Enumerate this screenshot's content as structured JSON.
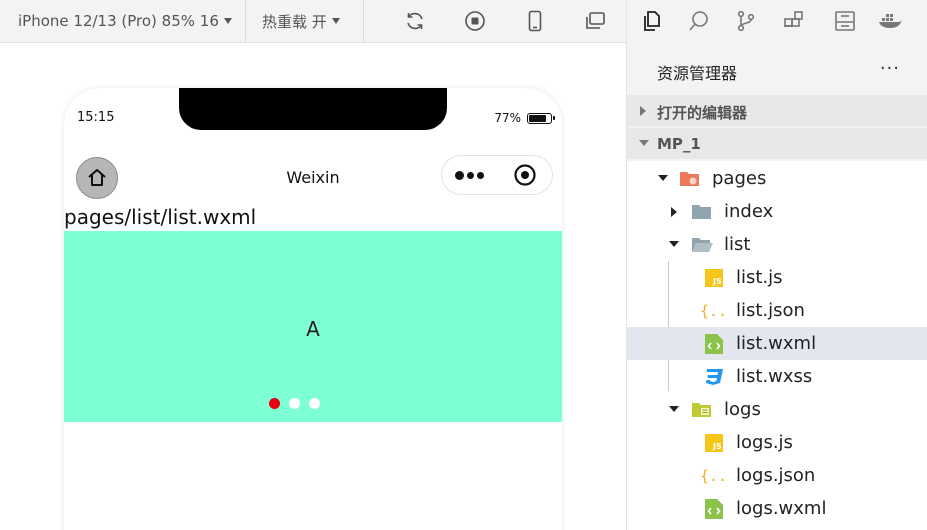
{
  "toolbar": {
    "device_select": "iPhone 12/13 (Pro) 85% 16",
    "hot_reload_select": "热重载 开"
  },
  "phone": {
    "status": {
      "time": "15:15",
      "battery": "77%",
      "battery_level": 0.77
    },
    "nav": {
      "title": "Weixin"
    },
    "page_path": "pages/list/list.wxml",
    "swiper": {
      "text": "A",
      "background": "#7fffd4",
      "dots": 3,
      "active_dot": 0,
      "active_color": "#e60012"
    }
  },
  "explorer": {
    "title": "资源管理器",
    "more": "···",
    "sections": [
      {
        "label": "打开的编辑器",
        "expanded": false
      },
      {
        "label": "MP_1",
        "expanded": true
      }
    ],
    "tree": [
      {
        "name": "pages",
        "type": "folder-pages",
        "expanded": true
      },
      {
        "name": "index",
        "type": "folder",
        "expanded": false
      },
      {
        "name": "list",
        "type": "folder",
        "expanded": true
      },
      {
        "name": "list.js",
        "type": "js"
      },
      {
        "name": "list.json",
        "type": "json"
      },
      {
        "name": "list.wxml",
        "type": "wxml",
        "selected": true
      },
      {
        "name": "list.wxss",
        "type": "wxss"
      },
      {
        "name": "logs",
        "type": "folder-logs",
        "expanded": true
      },
      {
        "name": "logs.js",
        "type": "js"
      },
      {
        "name": "logs.json",
        "type": "json"
      },
      {
        "name": "logs.wxml",
        "type": "wxml"
      }
    ]
  }
}
